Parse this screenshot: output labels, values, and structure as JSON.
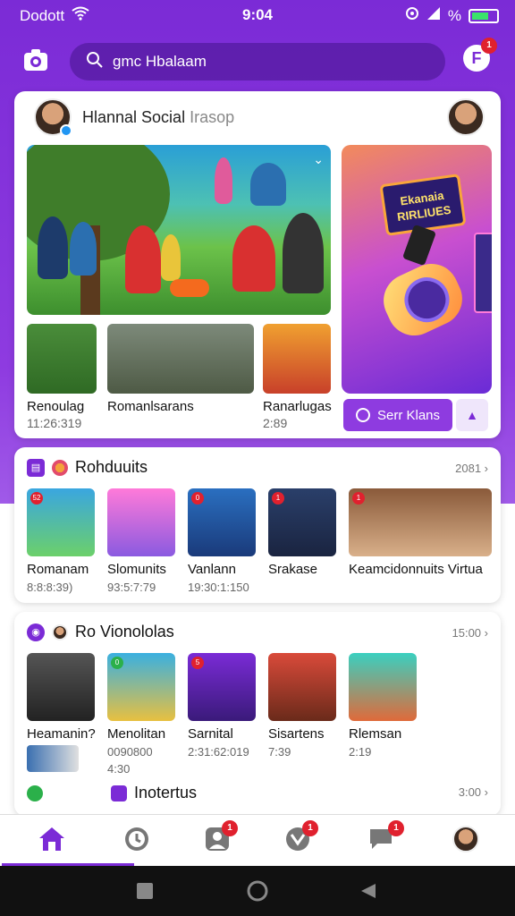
{
  "status": {
    "carrier": "Dodott",
    "time": "9:04",
    "battery": "%"
  },
  "header": {
    "search_text": "gmc Hbalaam",
    "profile_badge": "1"
  },
  "featured": {
    "title": "Hlannal Social",
    "title_sub": "Irasop",
    "promo_sign": "Ekanaia RIRLIUES",
    "thumbs": [
      {
        "title": "Renoulag",
        "meta": "11:26:319"
      },
      {
        "title": "Romanlsarans",
        "meta": ""
      },
      {
        "title": "Ranarlugas",
        "meta": "2:89"
      }
    ],
    "see_button": "Serr Klans",
    "share_icon": "share-icon"
  },
  "section1": {
    "title": "Rohduuits",
    "count": "2081",
    "items": [
      {
        "title": "Romanam",
        "meta": "8:8:8:39)",
        "num": "52"
      },
      {
        "title": "Slomunits",
        "meta": "93:5:7:79",
        "num": ""
      },
      {
        "title": "Vanlann",
        "meta": "19:30:1:150",
        "num": "0"
      },
      {
        "title": "Srakase",
        "meta": "",
        "num": "1"
      },
      {
        "title": "Keamcidonnuits Virtua",
        "meta": "",
        "num": "1"
      }
    ]
  },
  "section2": {
    "title": "Ro Vionololas",
    "count": "15:00",
    "items": [
      {
        "title": "Heamanin?",
        "meta": "",
        "num": ""
      },
      {
        "title": "Menolitan",
        "meta": "0090800",
        "meta2": "4:30",
        "num": "0"
      },
      {
        "title": "Sarnital",
        "meta": "2:31:62:019",
        "num": "5"
      },
      {
        "title": "Sisartens",
        "meta": "7:39",
        "num": ""
      },
      {
        "title": "Rlemsan",
        "meta": "2:19",
        "num": ""
      }
    ],
    "sub_title": "Inotertus",
    "sub_count": "3:00"
  },
  "nav": {
    "badges": [
      "1",
      "1",
      "1"
    ]
  },
  "colors": {
    "accent": "#7b2bd6",
    "badge": "#e0212e"
  }
}
